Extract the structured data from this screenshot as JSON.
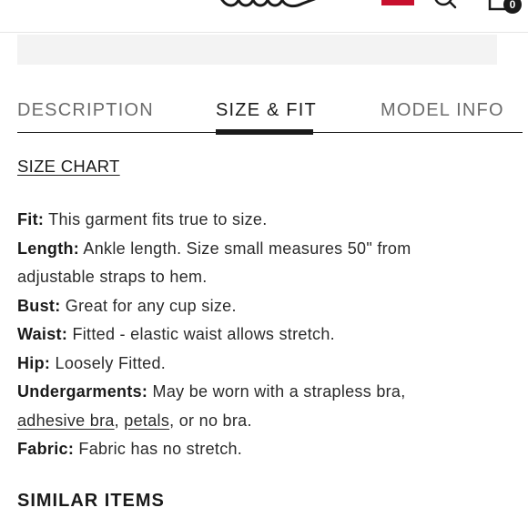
{
  "header": {
    "menu_icon": "hamburger-icon",
    "logo_icon": "lulus-logo",
    "flag_icon": "us-flag-icon",
    "search_icon": "search-icon",
    "bag_icon": "shopping-bag-icon",
    "bag_count": "0"
  },
  "tabs": [
    {
      "label": "DESCRIPTION",
      "active": false
    },
    {
      "label": "SIZE & FIT",
      "active": true
    },
    {
      "label": "MODEL INFO",
      "active": false
    }
  ],
  "size_chart_link": "SIZE CHART",
  "details": {
    "fit": {
      "label": "Fit:",
      "text": " This garment fits true to size."
    },
    "length": {
      "label": "Length:",
      "text": " Ankle length. Size small measures 50\" from",
      "text2": "adjustable straps to hem."
    },
    "bust": {
      "label": "Bust:",
      "text": " Great for any cup size."
    },
    "waist": {
      "label": "Waist:",
      "text": " Fitted - elastic waist allows stretch."
    },
    "hip": {
      "label": "Hip:",
      "text": " Loosely Fitted."
    },
    "undergarments": {
      "label": "Undergarments:",
      "text": " May be worn with a strapless bra,",
      "link1": "adhesive bra",
      "sep1": ", ",
      "link2": "petals",
      "text2": ", or no bra."
    },
    "fabric": {
      "label": "Fabric:",
      "text": " Fabric has no stretch."
    }
  },
  "similar_items": "SIMILAR ITEMS",
  "colors": {
    "text": "#1a1a1a",
    "muted_tab": "#6b6b6b",
    "strip": "#f3f3f3",
    "flag_red": "#c8102e"
  }
}
